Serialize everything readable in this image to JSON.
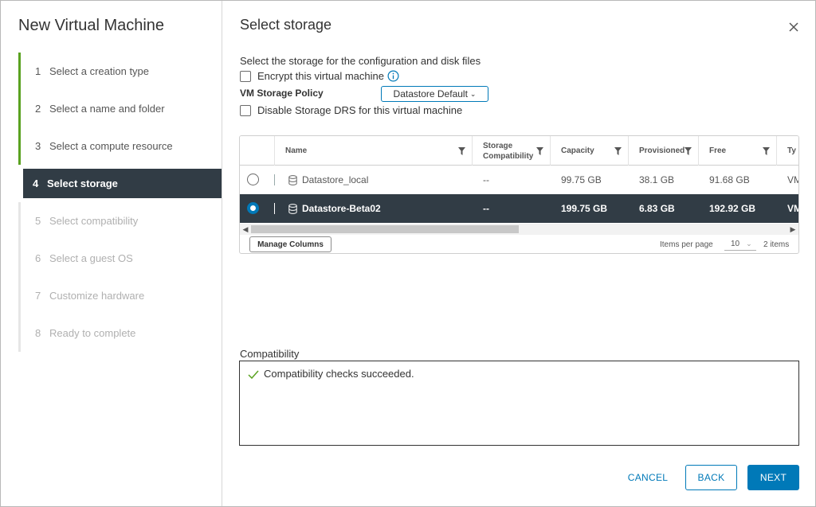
{
  "wizard": {
    "title": "New Virtual Machine",
    "steps": [
      {
        "num": "1",
        "label": "Select a creation type",
        "state": "done"
      },
      {
        "num": "2",
        "label": "Select a name and folder",
        "state": "done"
      },
      {
        "num": "3",
        "label": "Select a compute resource",
        "state": "done"
      },
      {
        "num": "4",
        "label": "Select storage",
        "state": "active"
      },
      {
        "num": "5",
        "label": "Select compatibility",
        "state": "future"
      },
      {
        "num": "6",
        "label": "Select a guest OS",
        "state": "future"
      },
      {
        "num": "7",
        "label": "Customize hardware",
        "state": "future"
      },
      {
        "num": "8",
        "label": "Ready to complete",
        "state": "future"
      }
    ]
  },
  "page": {
    "title": "Select storage",
    "description": "Select the storage for the configuration and disk files",
    "encrypt_label": "Encrypt this virtual machine",
    "policy_label": "VM Storage Policy",
    "policy_value": "Datastore Default",
    "disable_drs_label": "Disable Storage DRS for this virtual machine"
  },
  "table": {
    "columns": {
      "name": "Name",
      "storage_compat_line1": "Storage",
      "storage_compat_line2": "Compatibility",
      "capacity": "Capacity",
      "provisioned": "Provisioned",
      "free": "Free",
      "type": "Ty"
    },
    "rows": [
      {
        "name": "Datastore_local",
        "compat": "--",
        "capacity": "99.75 GB",
        "provisioned": "38.1 GB",
        "free": "91.68 GB",
        "type": "VM",
        "selected": false
      },
      {
        "name": "Datastore-Beta02",
        "compat": "--",
        "capacity": "199.75 GB",
        "provisioned": "6.83 GB",
        "free": "192.92 GB",
        "type": "VM",
        "selected": true
      }
    ],
    "manage_columns": "Manage Columns",
    "items_per_page_label": "Items per page",
    "items_per_page_value": "10",
    "items_count": "2 items"
  },
  "compatibility": {
    "label": "Compatibility",
    "message": "Compatibility checks succeeded."
  },
  "buttons": {
    "cancel": "CANCEL",
    "back": "BACK",
    "next": "NEXT"
  },
  "colors": {
    "accent": "#0079b8",
    "selected_bg": "#313c45",
    "done": "#5aa220"
  }
}
